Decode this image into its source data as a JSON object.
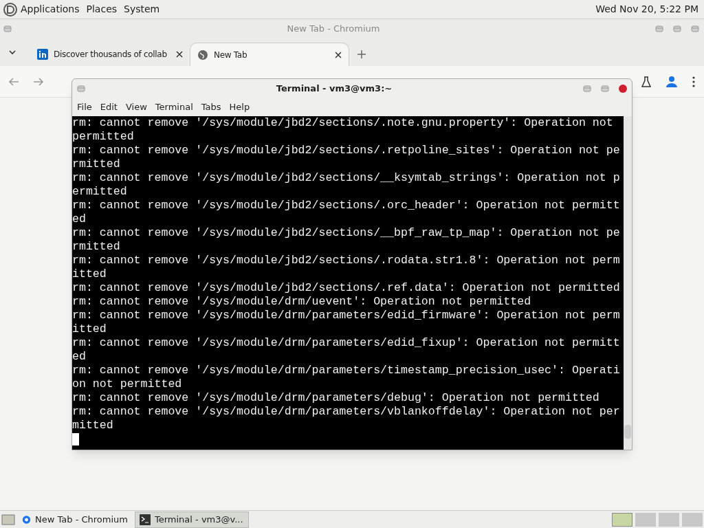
{
  "top_panel": {
    "menus": [
      "Applications",
      "Places",
      "System"
    ],
    "clock": "Wed Nov 20,  5:22 PM"
  },
  "browser": {
    "title": "New Tab - Chromium",
    "tabs": [
      {
        "label": "Discover thousands of collab",
        "selected": false
      },
      {
        "label": "New Tab",
        "selected": true
      }
    ]
  },
  "terminal": {
    "title": "Terminal - vm3@vm3:~",
    "menus": [
      "File",
      "Edit",
      "View",
      "Terminal",
      "Tabs",
      "Help"
    ],
    "lines": [
      "rm: cannot remove '/sys/module/jbd2/sections/.note.gnu.property': Operation not",
      "permitted",
      "rm: cannot remove '/sys/module/jbd2/sections/.retpoline_sites': Operation not pe",
      "rmitted",
      "rm: cannot remove '/sys/module/jbd2/sections/__ksymtab_strings': Operation not p",
      "ermitted",
      "rm: cannot remove '/sys/module/jbd2/sections/.orc_header': Operation not permitt",
      "ed",
      "rm: cannot remove '/sys/module/jbd2/sections/__bpf_raw_tp_map': Operation not pe",
      "rmitted",
      "rm: cannot remove '/sys/module/jbd2/sections/.rodata.str1.8': Operation not perm",
      "itted",
      "rm: cannot remove '/sys/module/jbd2/sections/.ref.data': Operation not permitted",
      "rm: cannot remove '/sys/module/drm/uevent': Operation not permitted",
      "rm: cannot remove '/sys/module/drm/parameters/edid_firmware': Operation not perm",
      "itted",
      "rm: cannot remove '/sys/module/drm/parameters/edid_fixup': Operation not permitt",
      "ed",
      "rm: cannot remove '/sys/module/drm/parameters/timestamp_precision_usec': Operati",
      "on not permitted",
      "rm: cannot remove '/sys/module/drm/parameters/debug': Operation not permitted",
      "rm: cannot remove '/sys/module/drm/parameters/vblankoffdelay': Operation not per",
      "mitted"
    ]
  },
  "taskbar": {
    "items": [
      {
        "label": "New Tab - Chromium",
        "kind": "browser",
        "selected": false
      },
      {
        "label": "Terminal - vm3@v...",
        "kind": "terminal",
        "selected": true
      }
    ]
  }
}
